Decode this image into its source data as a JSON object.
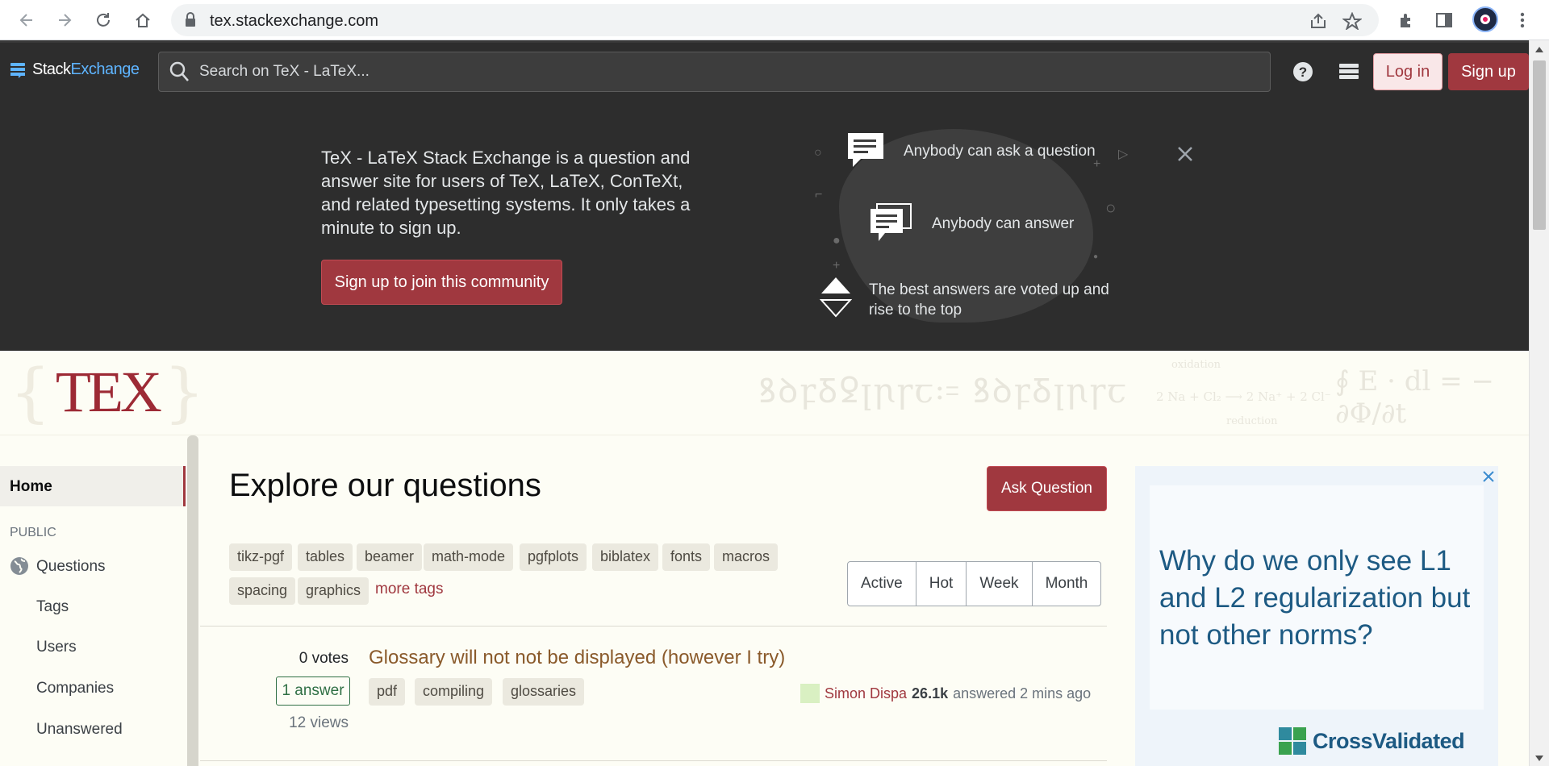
{
  "browser": {
    "url": "tex.stackexchange.com"
  },
  "topbar": {
    "logo_stack": "Stack",
    "logo_exchange": "Exchange",
    "search_placeholder": "Search on TeX - LaTeX...",
    "login_label": "Log in",
    "signup_label": "Sign up"
  },
  "hero": {
    "description": "TeX - LaTeX Stack Exchange is a question and answer site for users of TeX, LaTeX, ConTeXt, and related typesetting systems. It only takes a minute to sign up.",
    "cta_label": "Sign up to join this community",
    "features": [
      {
        "text": "Anybody can ask a question",
        "icon": "speech-bubble-icon"
      },
      {
        "text": "Anybody can answer",
        "icon": "speech-bubbles-icon"
      },
      {
        "text": "The best answers are voted up and rise to the top",
        "icon": "vote-arrows-icon"
      }
    ]
  },
  "site_header": {
    "logo_text": "TEX",
    "decor_formula": "2 Na + Cl₂ ⟶ 2 Na⁺ + 2 Cl⁻",
    "decor_oxidation": "oxidation",
    "decor_reduction": "reduction"
  },
  "sidebar": {
    "home": "Home",
    "section_label": "PUBLIC",
    "items": [
      "Questions",
      "Tags",
      "Users",
      "Companies",
      "Unanswered"
    ]
  },
  "main": {
    "title": "Explore our questions",
    "ask_label": "Ask Question",
    "tags_row1": [
      "tikz-pgf",
      "tables",
      "beamer",
      "math-mode",
      "pgfplots",
      "biblatex",
      "fonts",
      "macros"
    ],
    "tags_row2": [
      "spacing",
      "graphics"
    ],
    "more_tags": "more tags",
    "filters": [
      "Active",
      "Hot",
      "Week",
      "Month"
    ],
    "questions": [
      {
        "votes": "0 votes",
        "answers": "1 answer",
        "views": "12 views",
        "title": "Glossary will not not be displayed (however I try)",
        "tags": [
          "pdf",
          "compiling",
          "glossaries"
        ],
        "user": "Simon Dispa",
        "reputation": "26.1k",
        "action": "answered 2 mins ago"
      }
    ]
  },
  "ad": {
    "headline": "Why do we only see L1 and L2 regularization but not other norms?",
    "brand": "CrossValidated"
  },
  "colors": {
    "accent": "#a0383f",
    "topbar_bg": "#2d2d2d",
    "page_bg": "#fdfdf5",
    "answered_green": "#2f6f44",
    "link_blue": "#5eb4ff"
  }
}
